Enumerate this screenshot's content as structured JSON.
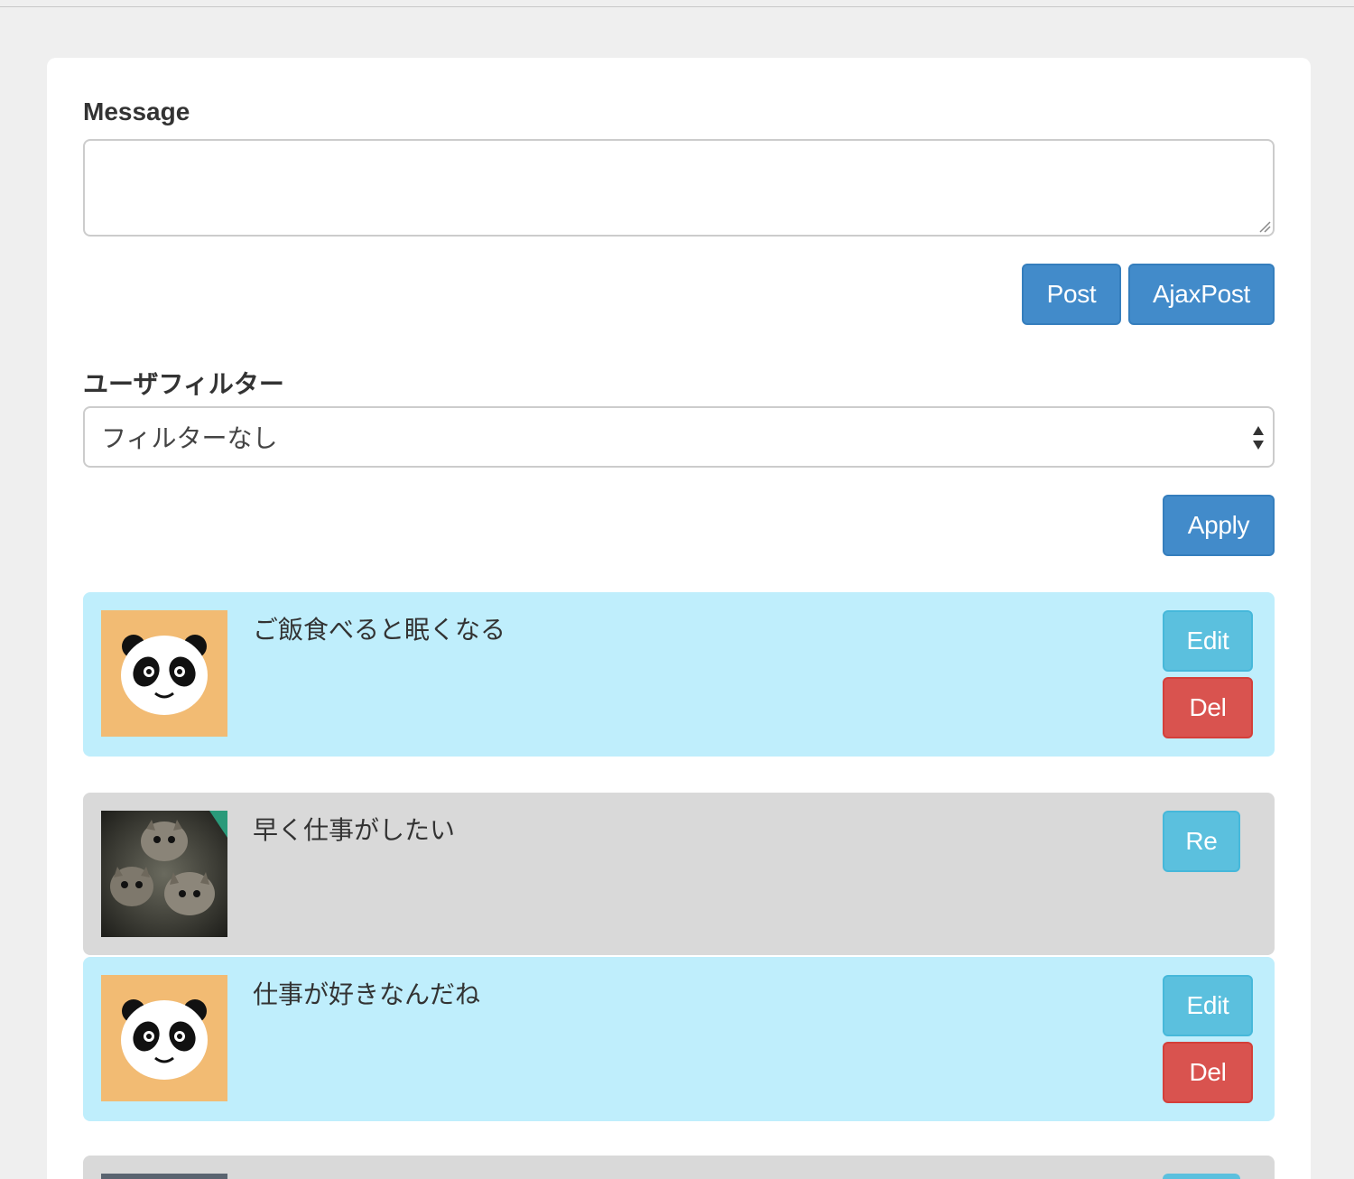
{
  "form": {
    "message_label": "Message",
    "message_value": "",
    "post_label": "Post",
    "ajax_post_label": "AjaxPost"
  },
  "filter": {
    "label": "ユーザフィルター",
    "selected": "フィルターなし",
    "apply_label": "Apply"
  },
  "posts": [
    {
      "text": "ご飯食べると眠くなる",
      "avatar": "panda-icon",
      "owner": "mine",
      "edit_label": "Edit",
      "del_label": "Del"
    },
    {
      "text": "早く仕事がしたい",
      "avatar": "kittens-photo",
      "owner": "other",
      "reply_label": "Re"
    },
    {
      "text": "仕事が好きなんだね",
      "avatar": "panda-icon",
      "owner": "mine",
      "edit_label": "Edit",
      "del_label": "Del"
    },
    {
      "text": "",
      "avatar": "cat-photo",
      "owner": "other"
    }
  ],
  "colors": {
    "page_bg": "#efefef",
    "mine_bg": "#bfeefc",
    "other_bg": "#d9d9d9",
    "primary": "#428bca",
    "info": "#5bc0de",
    "danger": "#d9534f",
    "panda_bg": "#f2bb73"
  }
}
